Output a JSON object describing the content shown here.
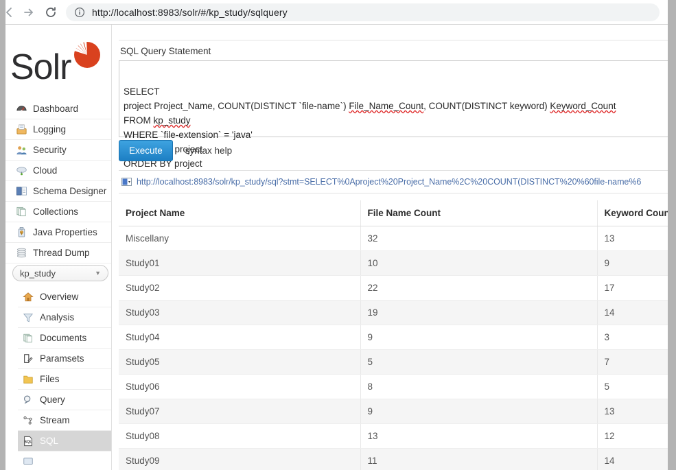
{
  "browser": {
    "url": "http://localhost:8983/solr/#/kp_study/sqlquery",
    "back_icon": "back-arrow-icon",
    "forward_icon": "forward-arrow-icon",
    "reload_icon": "reload-icon",
    "site_info_icon": "info-circle-icon"
  },
  "sidebar": {
    "logo_text": "Solr",
    "global_items": [
      {
        "label": "Dashboard",
        "icon": "dashboard-icon"
      },
      {
        "label": "Logging",
        "icon": "logging-icon"
      },
      {
        "label": "Security",
        "icon": "security-icon"
      },
      {
        "label": "Cloud",
        "icon": "cloud-icon"
      },
      {
        "label": "Schema Designer",
        "icon": "schema-designer-icon"
      },
      {
        "label": "Collections",
        "icon": "collections-icon"
      },
      {
        "label": "Java Properties",
        "icon": "java-properties-icon"
      },
      {
        "label": "Thread Dump",
        "icon": "thread-dump-icon"
      }
    ],
    "core_selector": {
      "value": "kp_study",
      "caret": "▼"
    },
    "core_items": [
      {
        "label": "Overview",
        "icon": "overview-home-icon",
        "selected": false
      },
      {
        "label": "Analysis",
        "icon": "analysis-funnel-icon",
        "selected": false
      },
      {
        "label": "Documents",
        "icon": "documents-icon",
        "selected": false
      },
      {
        "label": "Paramsets",
        "icon": "paramsets-icon",
        "selected": false
      },
      {
        "label": "Files",
        "icon": "files-folder-icon",
        "selected": false
      },
      {
        "label": "Query",
        "icon": "query-magnifier-icon",
        "selected": false
      },
      {
        "label": "Stream",
        "icon": "stream-graph-icon",
        "selected": false
      },
      {
        "label": "SQL",
        "icon": "sql-document-icon",
        "selected": true
      }
    ]
  },
  "main": {
    "query_label": "SQL Query Statement",
    "sql_statement": "SELECT\nproject Project_Name, COUNT(DISTINCT `file-name`) File_Name_Count, COUNT(DISTINCT keyword) Keyword_Count\nFROM kp_study\nWHERE `file-extension` = 'java'\nGROUP BY project\nORDER BY project",
    "execute_label": "Execute",
    "syntax_help_label": "syntax help",
    "url_preview": "http://localhost:8983/solr/kp_study/sql?stmt=SELECT%0Aproject%20Project_Name%2C%20COUNT(DISTINCT%20%60file-name%6",
    "url_preview_icon": "select-dropdown-icon",
    "results": {
      "columns": [
        "Project Name",
        "File Name Count",
        "Keyword Count"
      ],
      "rows": [
        [
          "Miscellany",
          "32",
          "13"
        ],
        [
          "Study01",
          "10",
          "9"
        ],
        [
          "Study02",
          "22",
          "17"
        ],
        [
          "Study03",
          "19",
          "14"
        ],
        [
          "Study04",
          "9",
          "3"
        ],
        [
          "Study05",
          "5",
          "7"
        ],
        [
          "Study06",
          "8",
          "5"
        ],
        [
          "Study07",
          "9",
          "13"
        ],
        [
          "Study08",
          "13",
          "12"
        ],
        [
          "Study09",
          "11",
          "14"
        ]
      ]
    }
  },
  "colors": {
    "accent_blue": "#1d7fc4",
    "logo_red": "#d9411e",
    "selected_nav": "#d6d6d6",
    "link_blue": "#4a6ea8"
  }
}
